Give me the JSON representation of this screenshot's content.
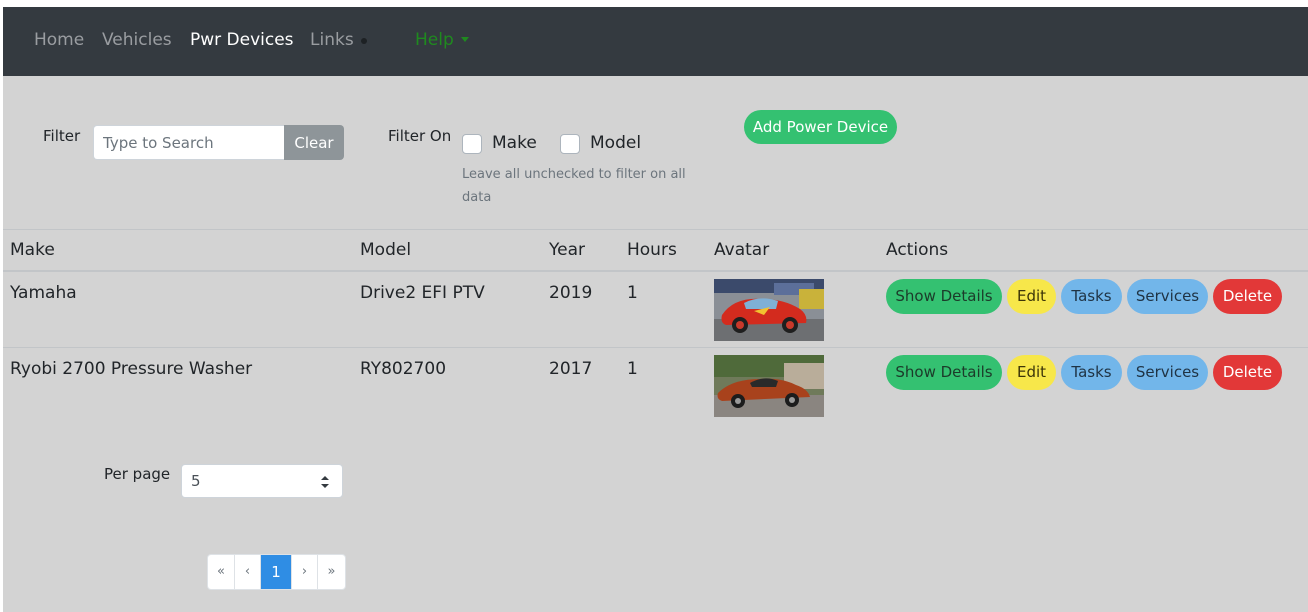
{
  "nav": {
    "items": [
      {
        "label": "Home",
        "active": false
      },
      {
        "label": "Vehicles",
        "active": false
      },
      {
        "label": "Pwr Devices",
        "active": true
      },
      {
        "label": "Links",
        "active": false
      }
    ],
    "help_label": "Help"
  },
  "filter": {
    "label": "Filter",
    "search_placeholder": "Type to Search",
    "search_value": "",
    "clear_label": "Clear",
    "filter_on_label": "Filter On",
    "options": [
      {
        "label": "Make",
        "checked": false
      },
      {
        "label": "Model",
        "checked": false
      }
    ],
    "hint": "Leave all unchecked to filter on all data"
  },
  "add_button_label": "Add Power Device",
  "table": {
    "headers": [
      "Make",
      "Model",
      "Year",
      "Hours",
      "Avatar",
      "Actions"
    ],
    "rows": [
      {
        "make": "Yamaha",
        "model": "Drive2 EFI PTV",
        "year": "2019",
        "hours": "1",
        "avatar": "red race car"
      },
      {
        "make": "Ryobi 2700 Pressure Washer",
        "model": "RY802700",
        "year": "2017",
        "hours": "1",
        "avatar": "orange sports car"
      }
    ],
    "actions": [
      "Show Details",
      "Edit",
      "Tasks",
      "Services",
      "Delete"
    ]
  },
  "per_page": {
    "label": "Per page",
    "value": "5"
  },
  "pagination": {
    "first": "«",
    "prev": "‹",
    "current": "1",
    "next": "›",
    "last": "»"
  },
  "colors": {
    "navbar": "#343a40",
    "background": "#d3d3d3",
    "success": "#34c171",
    "warning": "#f7e74a",
    "info": "#72b6ea",
    "danger": "#e23838",
    "primary": "#2f8de4"
  }
}
